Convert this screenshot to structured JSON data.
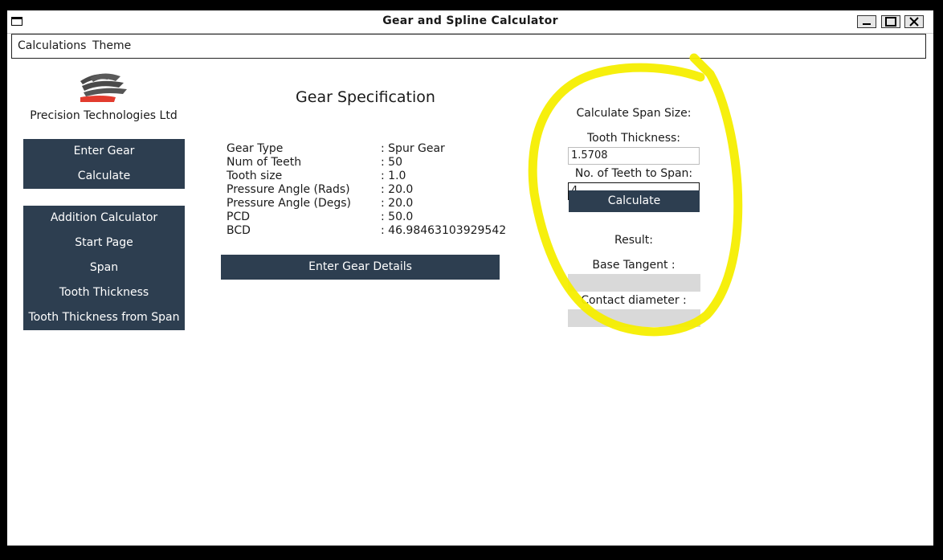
{
  "window": {
    "title": "Gear and Spline Calculator",
    "controls": {
      "minimize": "_",
      "maximize": "□",
      "close": "✕"
    }
  },
  "menu": {
    "items": [
      "Calculations",
      "Theme"
    ]
  },
  "sidebar": {
    "company": "Precision Technologies Ltd",
    "group1": [
      "Enter Gear",
      "Calculate"
    ],
    "group2": [
      "Addition Calculator",
      "Start Page",
      "Span",
      "Tooth Thickness",
      "Tooth Thickness from Span"
    ]
  },
  "spec": {
    "title": "Gear Specification",
    "rows": [
      {
        "key": "Gear Type",
        "value": ": Spur Gear"
      },
      {
        "key": "Num of Teeth",
        "value": ": 50"
      },
      {
        "key": "Tooth size",
        "value": ": 1.0"
      },
      {
        "key": "Pressure Angle (Rads)",
        "value": ": 20.0"
      },
      {
        "key": "Pressure Angle (Degs)",
        "value": ": 20.0"
      },
      {
        "key": "PCD",
        "value": ": 50.0"
      },
      {
        "key": "BCD",
        "value": ": 46.98463103929542"
      }
    ],
    "button": "Enter Gear Details"
  },
  "span_calc": {
    "heading": "Calculate Span Size:",
    "tooth_thickness_label": "Tooth Thickness:",
    "tooth_thickness_value": "1.5708",
    "teeth_to_span_label": "No. of Teeth to Span:",
    "teeth_to_span_value": "4",
    "calculate_label": "Calculate",
    "result_label": "Result:",
    "base_tangent_label": "Base Tangent :",
    "contact_diameter_label": "Contact diameter :"
  },
  "colors": {
    "button_bg": "#2d3e50",
    "highlight": "#f5ee00",
    "logo_gray": "#4a4a4a",
    "logo_red": "#e23b2e"
  },
  "icons": {
    "window_icon": "window-icon",
    "logo": "company-logo-icon"
  }
}
